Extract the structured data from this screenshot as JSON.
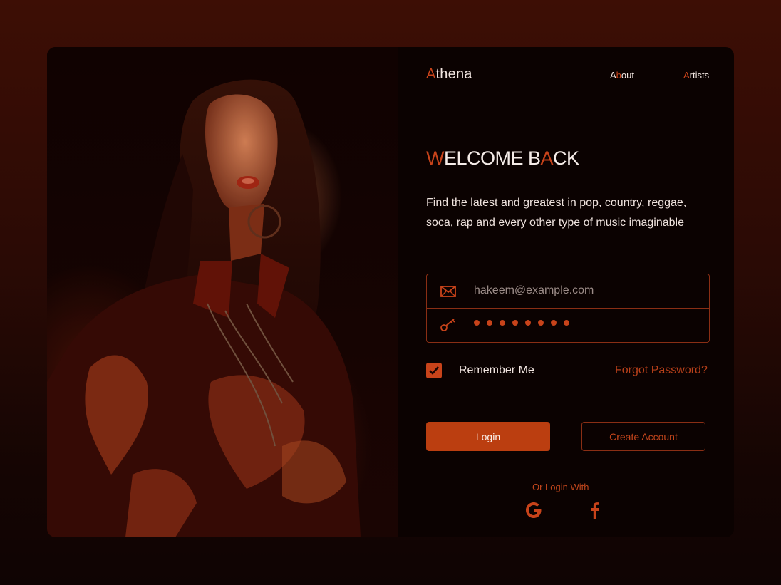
{
  "brand": {
    "first_letter": "A",
    "rest": "thena"
  },
  "nav": [
    {
      "first_letter": "A",
      "second_letter": "b",
      "rest": "out"
    },
    {
      "first_letter": "A",
      "rest": "rtists"
    }
  ],
  "welcome": {
    "w": "W",
    "part1": "ELCOME B",
    "a": "A",
    "part2": "CK"
  },
  "description": "Find the latest and greatest in pop, country, reggae, soca, rap and every other type of music imaginable",
  "form": {
    "email_placeholder": "hakeem@example.com",
    "password_dot_count": 8,
    "remember_label": "Remember Me",
    "remember_checked": true,
    "forgot_label": "Forgot Password?",
    "login_label": "Login",
    "create_label": "Create Account"
  },
  "social": {
    "label": "Or Login With",
    "providers": [
      {
        "name": "google",
        "icon": "google-icon"
      },
      {
        "name": "facebook",
        "icon": "facebook-icon"
      }
    ]
  },
  "colors": {
    "accent": "#c8431a",
    "card": "#0b0201",
    "text": "#f3e7e2"
  }
}
